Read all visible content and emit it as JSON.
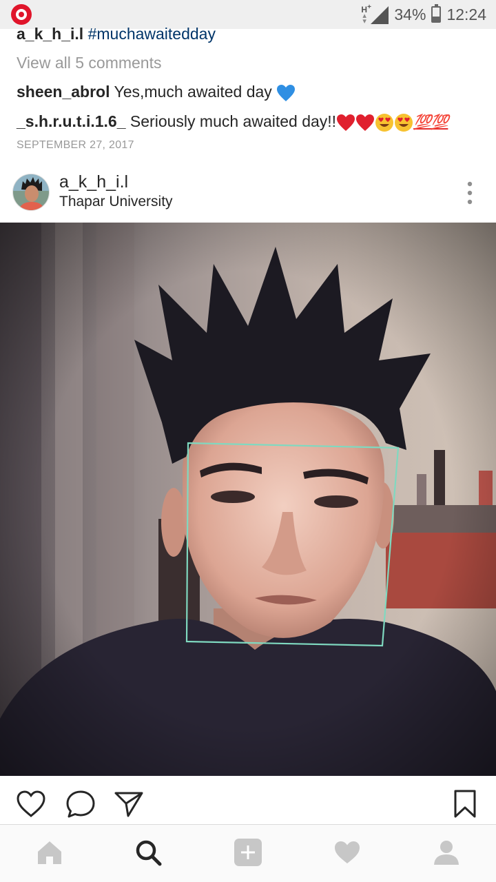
{
  "status_bar": {
    "network_type": "H",
    "network_plus": "+",
    "battery_percent": "34%",
    "battery_level": 0.34,
    "time": "12:24"
  },
  "previous_post": {
    "caption_user": "a_k_h_i.l",
    "caption_tag": "#muchawaitedday",
    "view_comments": "View all 5 comments",
    "comments": [
      {
        "user": "sheen_abrol",
        "text": "Yes,much awaited day"
      },
      {
        "user": "_s.h.r.u.t.i.1.6_",
        "text": "Seriously much awaited day!!",
        "emoji_100": "💯💯"
      }
    ],
    "date": "SEPTEMBER 27, 2017"
  },
  "post": {
    "username": "a_k_h_i.l",
    "location": "Thapar University"
  },
  "icons": {
    "status_app": "app-notification-icon",
    "like": "heart-outline-icon",
    "comment": "comment-bubble-icon",
    "share": "send-paper-plane-icon",
    "save": "bookmark-icon",
    "more": "more-vertical-icon",
    "nav": [
      "home-icon",
      "search-icon",
      "add-post-icon",
      "activity-heart-icon",
      "profile-icon"
    ]
  },
  "colors": {
    "status_bar_bg": "#efefef",
    "brand_red": "#e0152b",
    "hashtag": "#003569",
    "meta_gray": "#999999",
    "face_box": "#7fd9c0",
    "nav_inactive": "#c7c7c7"
  }
}
